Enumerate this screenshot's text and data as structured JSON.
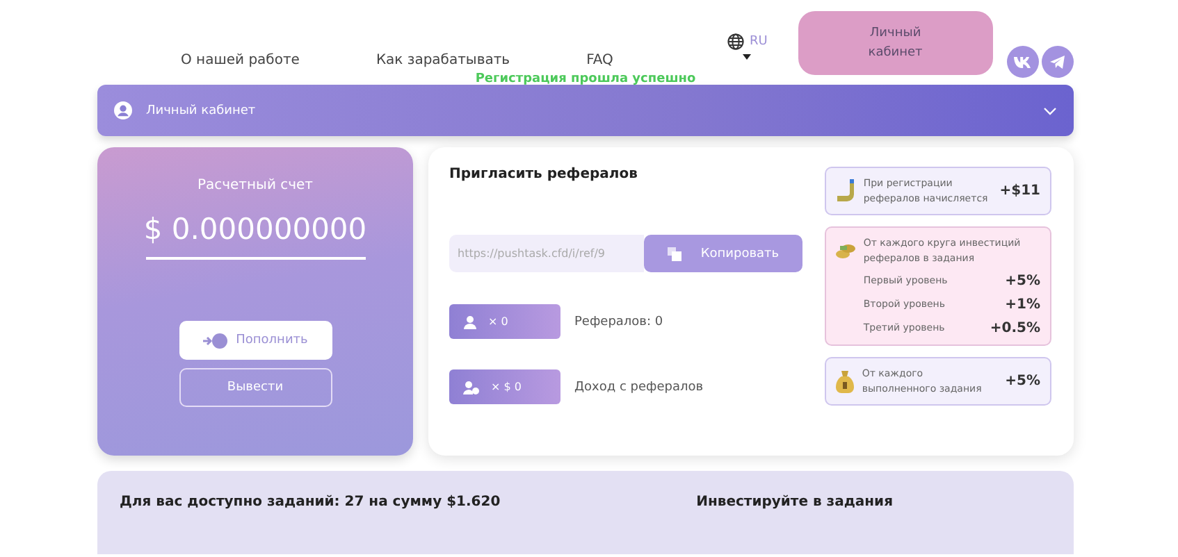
{
  "nav": {
    "items": [
      "О нашей работе",
      "Как зарабатывать",
      "FAQ"
    ],
    "language": "RU",
    "cabinet_button": "Личный кабинет"
  },
  "success_message": "Регистрация прошла успешно",
  "accordion": {
    "title": "Личный кабинет",
    "expanded": false
  },
  "balance": {
    "title": "Расчетный счет",
    "amount": "$ 0.000000000",
    "deposit_button": "Пополнить",
    "withdraw_button": "Вывести"
  },
  "referrals": {
    "title": "Пригласить рефералов",
    "link": "https://pushtask.cfd/i/ref/9",
    "copy_button": "Копировать",
    "stats": [
      {
        "kind": "count",
        "badge": "× 0",
        "label": "Рефералов: 0"
      },
      {
        "kind": "income",
        "badge": "× $ 0",
        "label": "Доход с рефералов"
      }
    ]
  },
  "rewards": [
    {
      "kind": "registration",
      "text": "При регистрации рефералов начисляется",
      "value": "+$11"
    },
    {
      "kind": "levels",
      "text": "От каждого круга инвестиций рефералов в задания",
      "levels": [
        {
          "label": "Первый уровень",
          "value": "+5%"
        },
        {
          "label": "Второй уровень",
          "value": "+1%"
        },
        {
          "label": "Третий уровень",
          "value": "+0.5%"
        }
      ]
    },
    {
      "kind": "task",
      "text": "От каждого выполненного задания",
      "value": "+5%"
    }
  ],
  "tasks": {
    "available": "Для вас доступно заданий: 27 на сумму $1.620",
    "invest": "Инвестируйте в задания"
  }
}
